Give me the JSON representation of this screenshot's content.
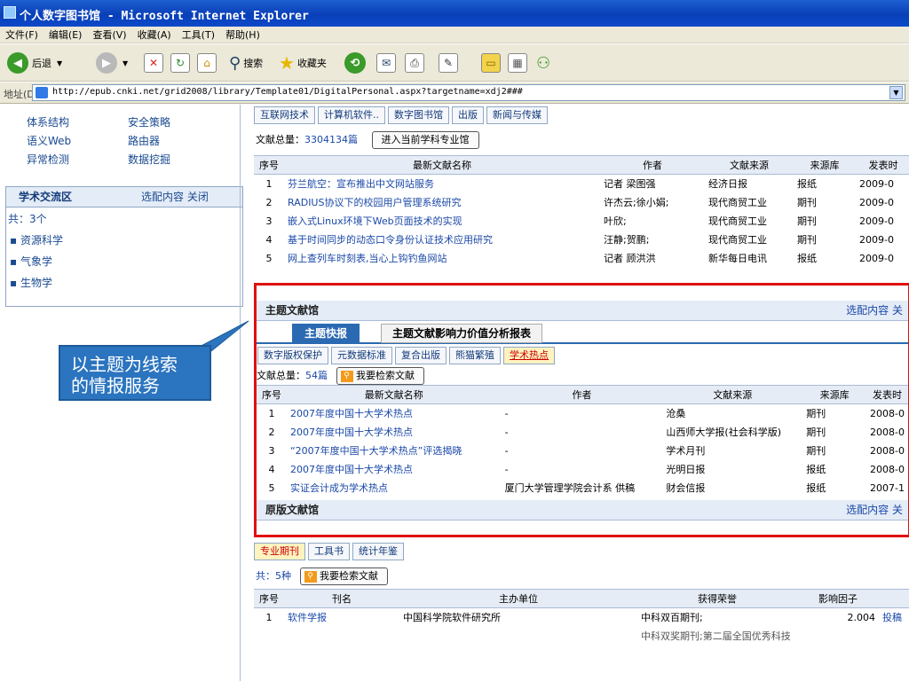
{
  "window": {
    "title": "个人数字图书馆 - Microsoft Internet Explorer"
  },
  "menu": [
    "文件(F)",
    "编辑(E)",
    "查看(V)",
    "收藏(A)",
    "工具(T)",
    "帮助(H)"
  ],
  "toolbar": {
    "back": "后退",
    "search": "搜索",
    "favorites": "收藏夹"
  },
  "address": {
    "label": "地址(D)",
    "url": "http://epub.cnki.net/grid2008/library/Template01/DigitalPersonal.aspx?targetname=xdj2###"
  },
  "left": {
    "topics": [
      [
        "体系结构",
        "安全策略"
      ],
      [
        "语义Web",
        "路由器"
      ],
      [
        "异常检测",
        "数据挖掘"
      ]
    ],
    "exchange": {
      "title": "学术交流区",
      "actions": "选配内容 关闭",
      "count": "共：3个",
      "items": [
        "资源科学",
        "气象学",
        "生物学"
      ]
    }
  },
  "callout": {
    "line1": "以主题为线索",
    "line2": "的情报服务"
  },
  "top": {
    "tabs": [
      "互联网技术",
      "计算机软件..",
      "数字图书馆",
      "出版",
      "新闻与传媒"
    ],
    "total_label": "文献总量：",
    "total": "3304134篇",
    "enter_btn": "进入当前学科专业馆",
    "headers": [
      "序号",
      "最新文献名称",
      "作者",
      "文献来源",
      "来源库",
      "发表时"
    ],
    "rows": [
      [
        "1",
        "芬兰航空：宣布推出中文网站服务",
        "记者 梁图强",
        "经济日报",
        "报纸",
        "2009-0"
      ],
      [
        "2",
        "RADIUS协议下的校园用户管理系统研究",
        "许杰云;徐小娟;",
        "现代商贸工业",
        "期刊",
        "2009-0"
      ],
      [
        "3",
        "嵌入式Linux环境下Web页面技术的实现",
        "叶欣;",
        "现代商贸工业",
        "期刊",
        "2009-0"
      ],
      [
        "4",
        "基于时间同步的动态口令身份认证技术应用研究",
        "汪静;贺鹏;",
        "现代商贸工业",
        "期刊",
        "2009-0"
      ],
      [
        "5",
        "网上查列车时刻表,当心上钩钓鱼网站",
        "记者 顾洪洪",
        "新华每日电讯",
        "报纸",
        "2009-0"
      ]
    ]
  },
  "theme": {
    "title": "主题文献馆",
    "actions": "选配内容 关",
    "subtabs": [
      "主题快报",
      "主题文献影响力价值分析报表"
    ],
    "topics": [
      "数字版权保护",
      "元数据标准",
      "复合出版",
      "熊猫繁殖",
      "学术热点"
    ],
    "total_label": "文献总量：",
    "total": "54篇",
    "search_btn": "我要检索文献",
    "headers": [
      "序号",
      "最新文献名称",
      "作者",
      "文献来源",
      "来源库",
      "发表时"
    ],
    "rows": [
      [
        "1",
        "2007年度中国十大学术热点",
        "-",
        "沧桑",
        "期刊",
        "2008-0"
      ],
      [
        "2",
        "2007年度中国十大学术热点",
        "-",
        "山西师大学报(社会科学版)",
        "期刊",
        "2008-0"
      ],
      [
        "3",
        "“2007年度中国十大学术热点”评选揭晓",
        "-",
        "学术月刊",
        "期刊",
        "2008-0"
      ],
      [
        "4",
        "2007年度中国十大学术热点",
        "-",
        "光明日报",
        "报纸",
        "2008-0"
      ],
      [
        "5",
        "实证会计成为学术热点",
        "厦门大学管理学院会计系 供稿",
        "财会信报",
        "报纸",
        "2007-1"
      ]
    ]
  },
  "original": {
    "title": "原版文献馆",
    "actions": "选配内容 关"
  },
  "journal": {
    "tabs": [
      "专业期刊",
      "工具书",
      "统计年鉴"
    ],
    "count": "共：5种",
    "search_btn": "我要检索文献",
    "headers": [
      "序号",
      "刊名",
      "主办单位",
      "获得荣誉",
      "影响因子"
    ],
    "row": [
      "1",
      "软件学报",
      "中国科学院软件研究所",
      "中科双百期刊;",
      "2.004",
      "投稿"
    ],
    "row_extra": "中科双奖期刊;第二届全国优秀科技"
  }
}
